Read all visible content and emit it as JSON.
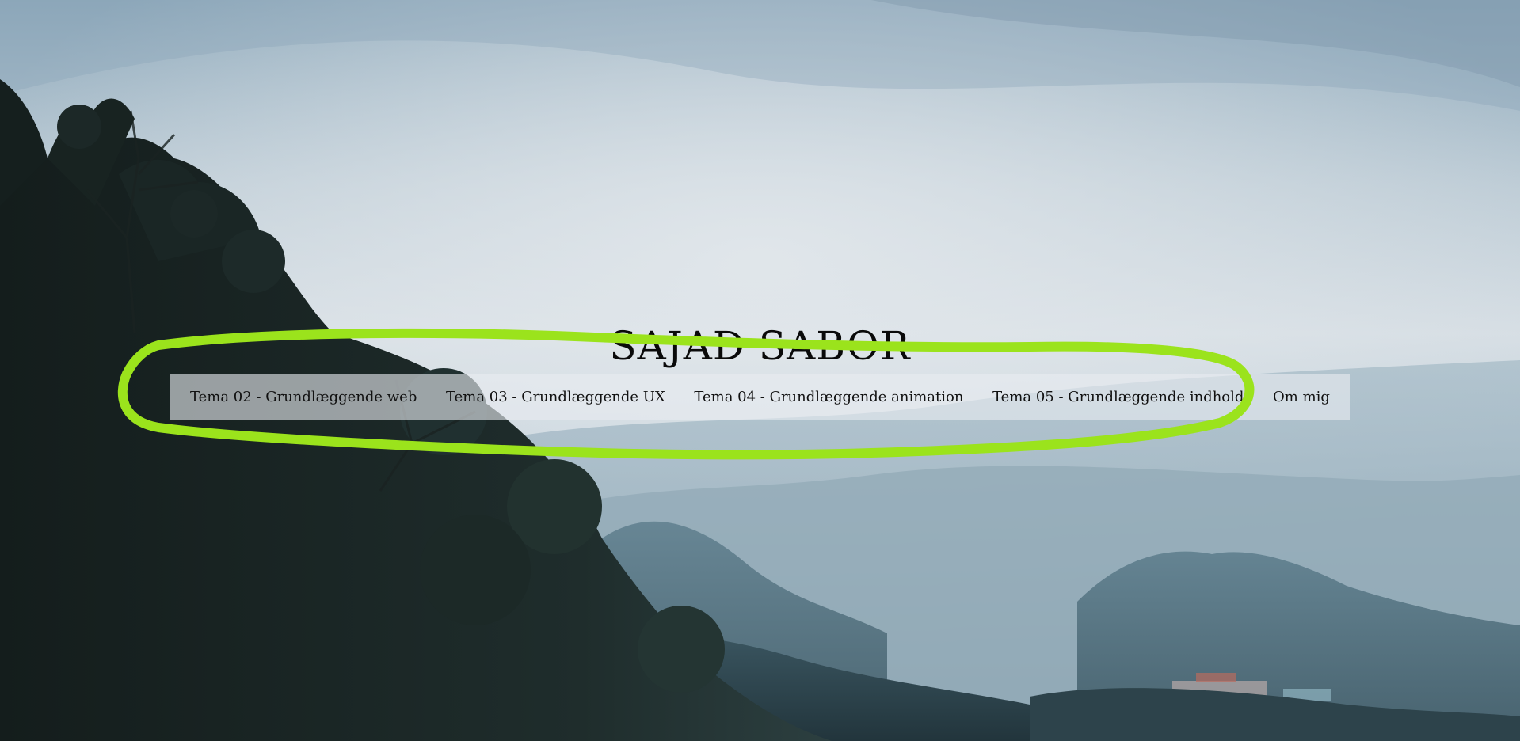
{
  "site": {
    "title": "SAJAD SABOR"
  },
  "nav": {
    "items": [
      {
        "label": "Tema 02 - Grundlæggende web"
      },
      {
        "label": "Tema 03 - Grundlæggende UX"
      },
      {
        "label": "Tema 04 - Grundlæggende animation"
      },
      {
        "label": "Tema 05 - Grundlæggende indhold"
      },
      {
        "label": "Om mig"
      }
    ]
  },
  "colors": {
    "annotation_ring": "#9be31c",
    "nav_background": "#e8ecf0",
    "title_text": "#0a0a0a"
  },
  "background": {
    "scene": "misty-forest-valley-photo"
  }
}
